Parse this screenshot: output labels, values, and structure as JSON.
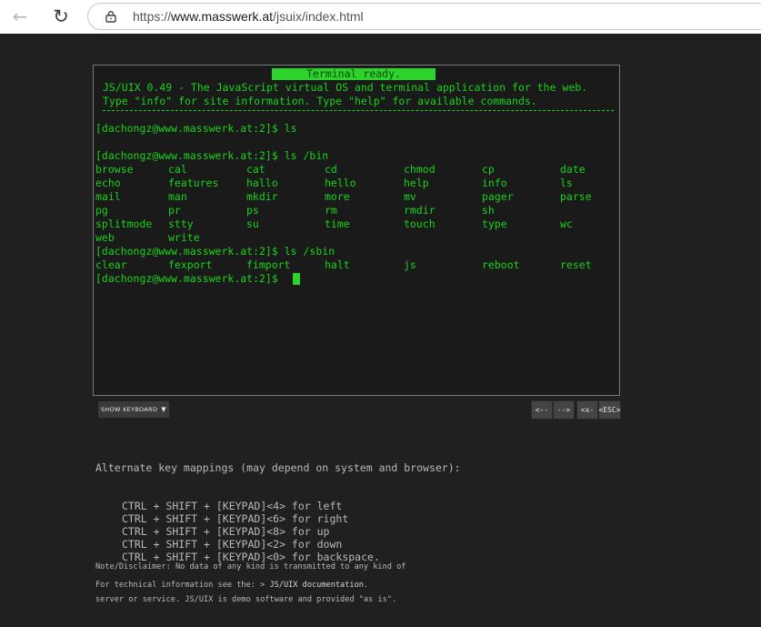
{
  "browser": {
    "url_prefix": "https://",
    "url_host": "www.masswerk.at",
    "url_path": "/jsuix/index.html"
  },
  "terminal": {
    "status": "Terminal ready.",
    "banner_line1": "JS/UIX 0.49 - The JavaScript virtual OS and terminal application for the web.",
    "banner_line2": "Type \"info\" for site information. Type \"help\" for available commands.",
    "prompt": "[dachongz@www.masswerk.at:2]$",
    "cmd1": "ls",
    "cmd2": "ls /bin",
    "cmd3": "ls /sbin",
    "bin_rows": [
      [
        "browse",
        "cal",
        "cat",
        "cd",
        "chmod",
        "cp",
        "date"
      ],
      [
        "echo",
        "features",
        "hallo",
        "hello",
        "help",
        "info",
        "ls"
      ],
      [
        "mail",
        "man",
        "mkdir",
        "more",
        "mv",
        "pager",
        "parse"
      ],
      [
        "pg",
        "pr",
        "ps",
        "rm",
        "rmdir",
        "sh",
        ""
      ],
      [
        "splitmode",
        "stty",
        "su",
        "time",
        "touch",
        "type",
        "wc"
      ],
      [
        "web",
        "write",
        "",
        "",
        "",
        "",
        ""
      ]
    ],
    "sbin_row": [
      "clear",
      "fexport",
      "fimport",
      "halt",
      "js",
      "reboot",
      "reset"
    ]
  },
  "controls": {
    "show_keyboard": "SHOW KEYBOARD",
    "key_left": "<--",
    "key_right": "-->",
    "key_bs": "<x-",
    "key_esc": "<ESC>"
  },
  "mappings": {
    "title": "Alternate key mappings (may depend on system and browser):",
    "lines": [
      "CTRL + SHIFT + [KEYPAD]<4> for left",
      "CTRL + SHIFT + [KEYPAD]<6> for right",
      "CTRL + SHIFT + [KEYPAD]<8> for up",
      "CTRL + SHIFT + [KEYPAD]<2> for down",
      "CTRL + SHIFT + [KEYPAD]<0> for backspace."
    ]
  },
  "disclaimer": {
    "line1": "Note/Disclaimer: No data of any kind is transmitted to any kind of",
    "line2": "server or service. JS/UIX is demo software and provided \"as is\"."
  },
  "techinfo": {
    "text": "For technical information see the: > ",
    "link": "JS/UIX documentation",
    "suffix": "."
  }
}
